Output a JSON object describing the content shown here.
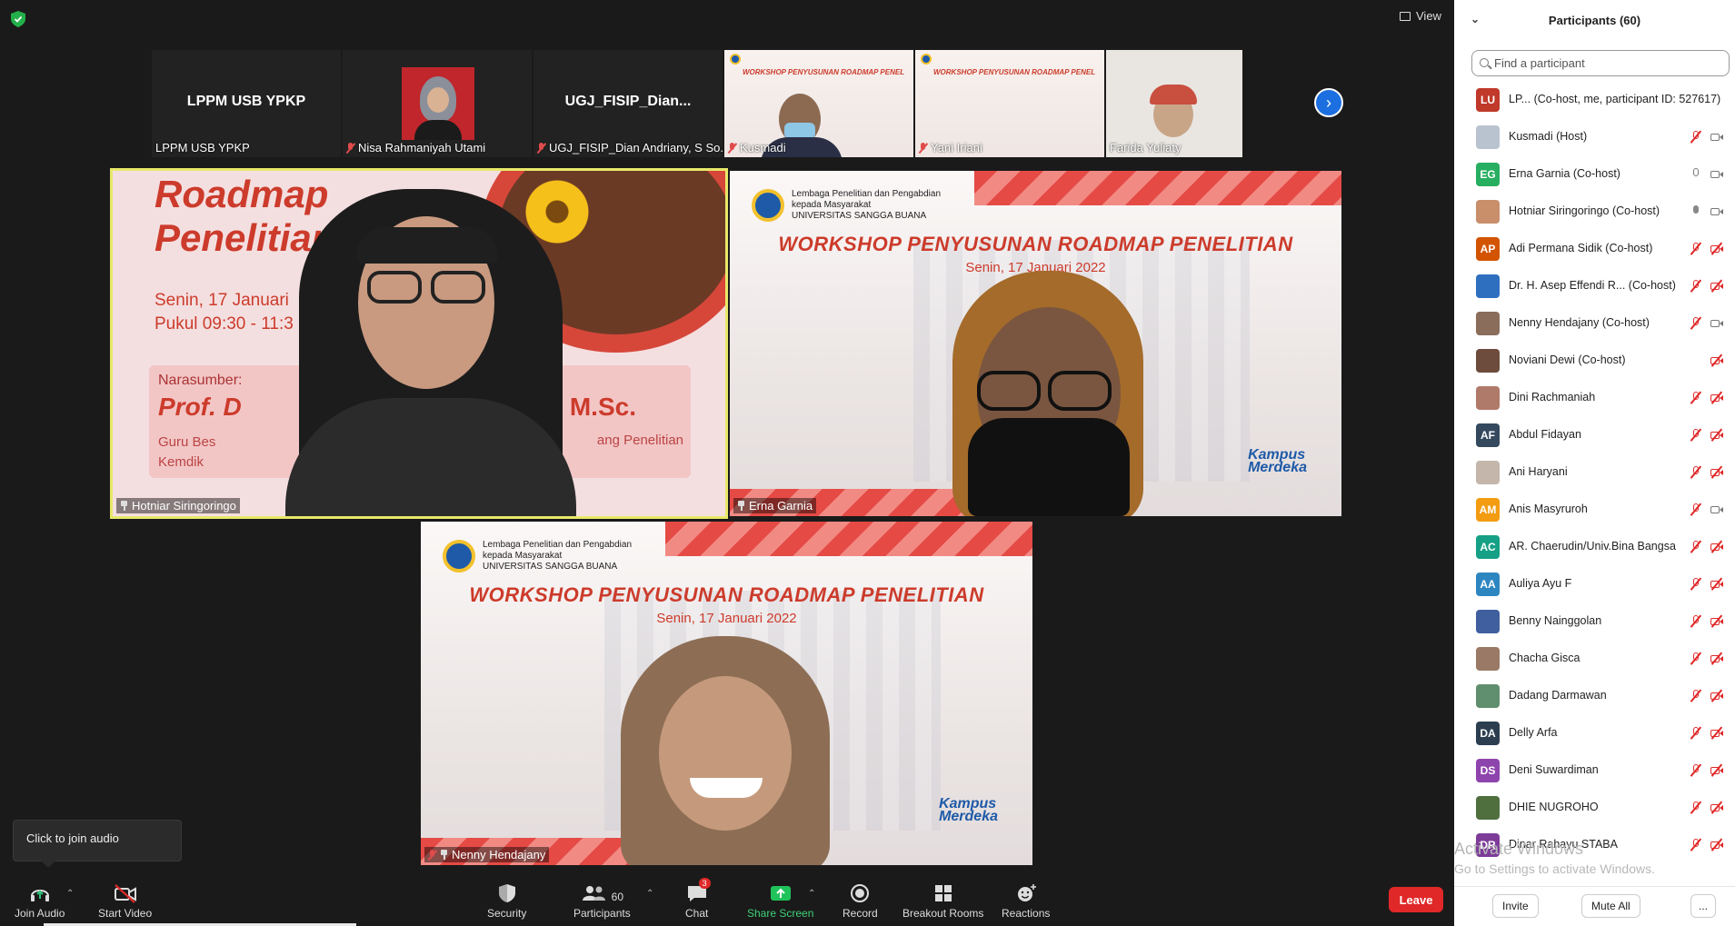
{
  "view_label": "View",
  "strip": [
    {
      "name": "LPPM USB YPKP",
      "big": "LPPM USB YPKP",
      "muted": false,
      "type": "text"
    },
    {
      "name": "Nisa Rahmaniyah Utami",
      "muted": true,
      "type": "photo"
    },
    {
      "name": "UGJ_FISIP_Dian Andriany, S So...",
      "big": "UGJ_FISIP_Dian...",
      "muted": true,
      "type": "text"
    },
    {
      "name": "Kusmadi",
      "muted": true,
      "type": "slide",
      "slide_text": "WORKSHOP PENYUSUNAN ROADMAP PENELITIAN"
    },
    {
      "name": "Yani Iriani",
      "muted": true,
      "type": "slide",
      "slide_text": "WORKSHOP PENYUSUNAN ROADMAP PENELITIAN"
    },
    {
      "name": "Farida Yuliaty",
      "muted": false,
      "type": "photo"
    }
  ],
  "tiles": {
    "hotniar": {
      "name": "Hotniar Siringoringo",
      "slide_title_1": "Roadmap",
      "slide_title_2": "Penelitian",
      "slide_date": "Senin, 17 Januari",
      "slide_time": "Pukul 09:30 - 11:3",
      "narasumber": "Narasumber:",
      "speaker": "Prof. D",
      "degree": "M.Sc.",
      "role_1": "Guru Bes",
      "role_2": "Kemdik",
      "role_3": "ang Penelitian"
    },
    "erna": {
      "name": "Erna Garnia"
    },
    "nenny": {
      "name": "Nenny Hendajany"
    },
    "slide": {
      "org_1": "Lembaga Penelitian dan Pengabdian",
      "org_2": "kepada Masyarakat",
      "org_3": "UNIVERSITAS SANGGA BUANA",
      "title": "WORKSHOP PENYUSUNAN ROADMAP PENELITIAN",
      "date": "Senin, 17 Januari 2022",
      "kampus_1": "Kampus",
      "kampus_2": "Merdeka"
    }
  },
  "toolbar": {
    "join_audio": "Join Audio",
    "start_video": "Start Video",
    "security": "Security",
    "participants": "Participants",
    "participants_count": "60",
    "chat": "Chat",
    "chat_badge": "3",
    "share_screen": "Share Screen",
    "record": "Record",
    "breakout_rooms": "Breakout Rooms",
    "reactions": "Reactions",
    "leave": "Leave",
    "tooltip": "Click to join audio"
  },
  "panel": {
    "title": "Participants (60)",
    "search_placeholder": "Find a participant",
    "invite": "Invite",
    "mute_all": "Mute All",
    "more": "...",
    "watermark_1": "Activate Windows",
    "watermark_2": "Go to Settings to activate Windows.",
    "participants": [
      {
        "initials": "LU",
        "color": "#c0392b",
        "name": "LP... (Co-host, me, participant ID: 527617)",
        "mic": "none",
        "cam": "none"
      },
      {
        "initials": "",
        "color": "#b9c3cf",
        "name": "Kusmadi (Host)",
        "mic": "muted",
        "cam": "on"
      },
      {
        "initials": "EG",
        "color": "#27ae60",
        "name": "Erna Garnia (Co-host)",
        "mic": "on",
        "cam": "on"
      },
      {
        "initials": "",
        "color": "#c98e6a",
        "name": "Hotniar Siringoringo (Co-host)",
        "mic": "active",
        "cam": "on"
      },
      {
        "initials": "AP",
        "color": "#d35400",
        "name": "Adi Permana Sidik (Co-host)",
        "mic": "muted",
        "cam": "off"
      },
      {
        "initials": "",
        "color": "#2f6fc0",
        "name": "Dr. H. Asep Effendi R... (Co-host)",
        "mic": "muted",
        "cam": "off"
      },
      {
        "initials": "",
        "color": "#8a6d5a",
        "name": "Nenny Hendajany (Co-host)",
        "mic": "muted",
        "cam": "on"
      },
      {
        "initials": "",
        "color": "#6d4c3d",
        "name": "Noviani Dewi (Co-host)",
        "mic": "none",
        "cam": "off"
      },
      {
        "initials": "",
        "color": "#b07a6a",
        "name": "Dini Rachmaniah",
        "mic": "muted",
        "cam": "off"
      },
      {
        "initials": "AF",
        "color": "#34495e",
        "name": "Abdul Fidayan",
        "mic": "muted",
        "cam": "off"
      },
      {
        "initials": "",
        "color": "#c4b6aa",
        "name": "Ani Haryani",
        "mic": "muted",
        "cam": "off"
      },
      {
        "initials": "AM",
        "color": "#f39c12",
        "name": "Anis Masyruroh",
        "mic": "muted",
        "cam": "on"
      },
      {
        "initials": "AC",
        "color": "#16a085",
        "name": "AR. Chaerudin/Univ.Bina Bangsa",
        "mic": "muted",
        "cam": "off"
      },
      {
        "initials": "AA",
        "color": "#2e86c1",
        "name": "Auliya Ayu F",
        "mic": "muted",
        "cam": "off"
      },
      {
        "initials": "",
        "color": "#3f5f9f",
        "name": "Benny Nainggolan",
        "mic": "muted",
        "cam": "off"
      },
      {
        "initials": "",
        "color": "#9a7a66",
        "name": "Chacha Gisca",
        "mic": "muted",
        "cam": "off"
      },
      {
        "initials": "",
        "color": "#5f8f6f",
        "name": "Dadang Darmawan",
        "mic": "muted",
        "cam": "off"
      },
      {
        "initials": "DA",
        "color": "#2c3e50",
        "name": "Delly Arfa",
        "mic": "muted",
        "cam": "off"
      },
      {
        "initials": "DS",
        "color": "#8e44ad",
        "name": "Deni Suwardiman",
        "mic": "muted",
        "cam": "off"
      },
      {
        "initials": "",
        "color": "#4f6f3f",
        "name": "DHIE NUGROHO",
        "mic": "muted",
        "cam": "off"
      },
      {
        "initials": "DR",
        "color": "#7d3c98",
        "name": "Dinar Rahayu STABA",
        "mic": "muted",
        "cam": "off"
      }
    ]
  }
}
